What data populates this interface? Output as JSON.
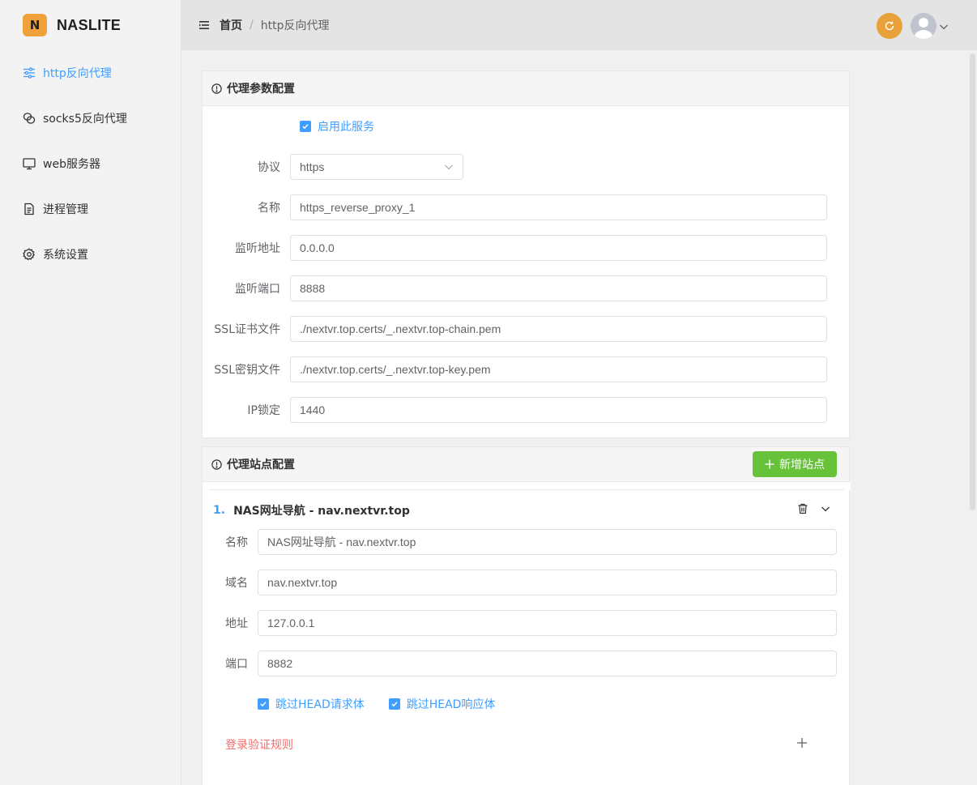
{
  "brand": {
    "logo_letter": "N",
    "name": "NASLITE"
  },
  "sidebar": {
    "items": [
      {
        "label": "http反向代理",
        "icon": "sliders-icon",
        "active": true
      },
      {
        "label": "socks5反向代理",
        "icon": "link-icon"
      },
      {
        "label": "web服务器",
        "icon": "monitor-icon"
      },
      {
        "label": "进程管理",
        "icon": "document-icon"
      },
      {
        "label": "系统设置",
        "icon": "gear-icon"
      }
    ]
  },
  "header": {
    "breadcrumb_home": "首页",
    "breadcrumb_sep": "/",
    "breadcrumb_current": "http反向代理"
  },
  "proxy_config": {
    "title": "代理参数配置",
    "enable_label": "启用此服务",
    "enable_checked": true,
    "protocol_label": "协议",
    "protocol_value": "https",
    "name_label": "名称",
    "name_value": "https_reverse_proxy_1",
    "listen_addr_label": "监听地址",
    "listen_addr_value": "0.0.0.0",
    "listen_port_label": "监听端口",
    "listen_port_value": "8888",
    "ssl_cert_label": "SSL证书文件",
    "ssl_cert_value": "./nextvr.top.certs/_.nextvr.top-chain.pem",
    "ssl_key_label": "SSL密钥文件",
    "ssl_key_value": "./nextvr.top.certs/_.nextvr.top-key.pem",
    "ip_lock_label": "IP锁定",
    "ip_lock_value": "1440"
  },
  "site_config": {
    "title": "代理站点配置",
    "add_button": "新增站点",
    "site": {
      "index": "1.",
      "title": "NAS网址导航 - nav.nextvr.top",
      "name_label": "名称",
      "name_value": "NAS网址导航 - nav.nextvr.top",
      "domain_label": "域名",
      "domain_value": "nav.nextvr.top",
      "addr_label": "地址",
      "addr_value": "127.0.0.1",
      "port_label": "端口",
      "port_value": "8882",
      "skip_req_label": "跳过HEAD请求体",
      "skip_req_checked": true,
      "skip_resp_label": "跳过HEAD响应体",
      "skip_resp_checked": true,
      "auth_rule_label": "登录验证规则"
    }
  },
  "colors": {
    "primary": "#409eff",
    "success": "#67c23a",
    "danger": "#f56c6c",
    "brand": "#f0a13a",
    "refresh": "#e9a23b"
  }
}
